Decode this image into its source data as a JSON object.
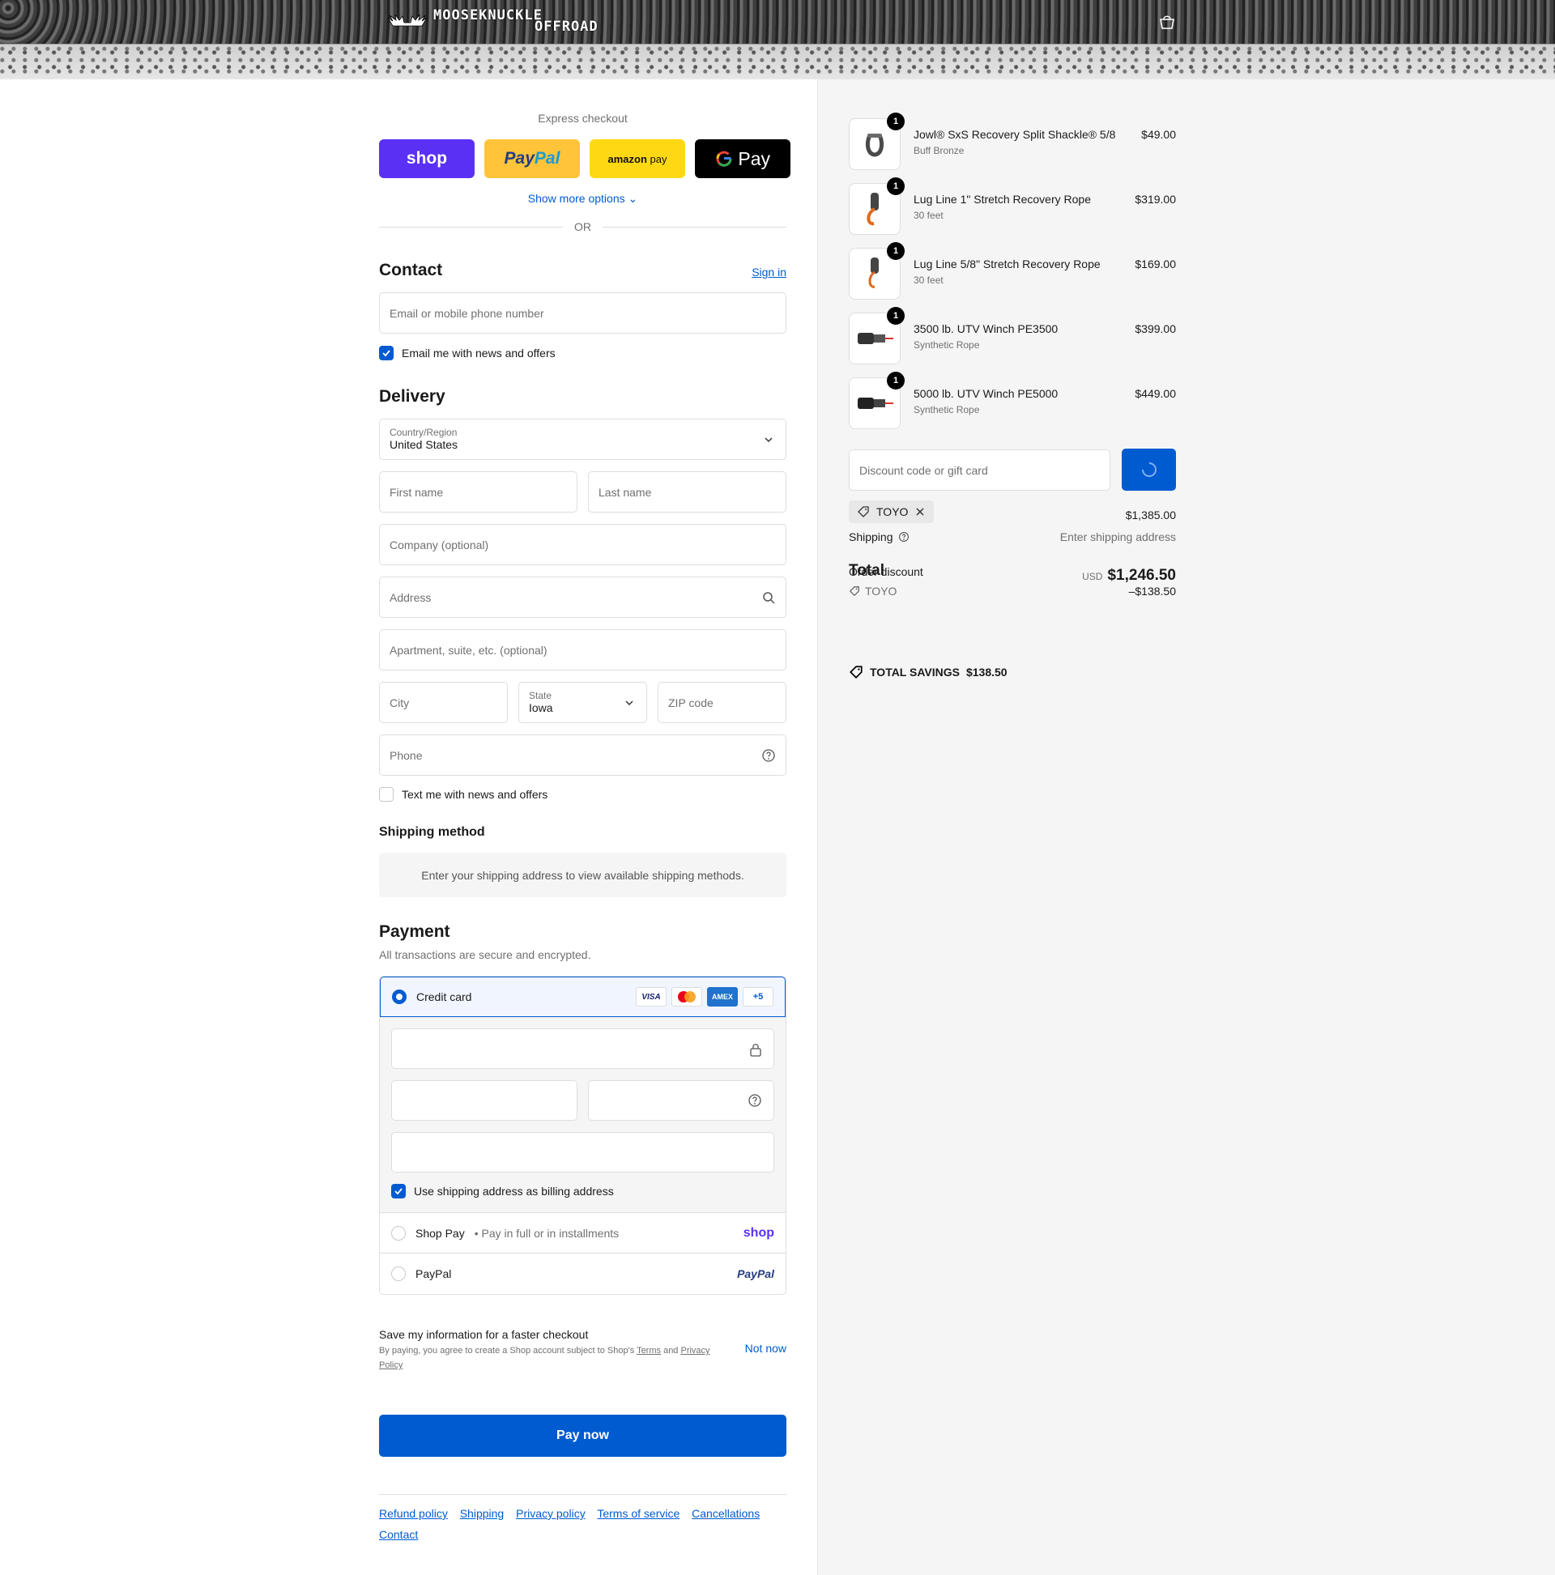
{
  "header": {
    "brand_line1": "MOOSEKNUCKLE",
    "brand_line2": "OFFROAD"
  },
  "express": {
    "title": "Express checkout",
    "shop_label": "shop",
    "paypal_a": "Pay",
    "paypal_b": "Pal",
    "amazon_label": "amazon",
    "amazon_pay": "pay",
    "gpay_label": "Pay",
    "show_more": "Show more options ⌄",
    "or": "OR"
  },
  "contact": {
    "title": "Contact",
    "sign_in": "Sign in",
    "email_placeholder": "Email or mobile phone number",
    "news_label": "Email me with news and offers"
  },
  "delivery": {
    "title": "Delivery",
    "country_label": "Country/Region",
    "country_value": "United States",
    "first_name": "First name",
    "last_name": "Last name",
    "company": "Company (optional)",
    "address": "Address",
    "apartment": "Apartment, suite, etc. (optional)",
    "city": "City",
    "state_label": "State",
    "state_value": "Iowa",
    "zip": "ZIP code",
    "phone": "Phone",
    "sms_label": "Text me with news and offers"
  },
  "shipping_method": {
    "title": "Shipping method",
    "message": "Enter your shipping address to view available shipping methods."
  },
  "payment": {
    "title": "Payment",
    "subtitle": "All transactions are secure and encrypted.",
    "credit_card": "Credit card",
    "badges": [
      "VISA",
      "",
      "AMEX",
      "+5"
    ],
    "billing_same": "Use shipping address as billing address",
    "shop_pay": "Shop Pay",
    "shop_pay_note": "• Pay in full or in installments",
    "shop_logo": "shop",
    "paypal": "PayPal",
    "paypal_logo": "PayPal"
  },
  "save_info": {
    "title": "Save my information for a faster checkout",
    "legal_prefix": "By paying, you agree to create a Shop account subject to Shop's ",
    "terms": "Terms",
    "and": " and ",
    "privacy": "Privacy Policy",
    "not_now": "Not now"
  },
  "pay_now": "Pay now",
  "footer_links": [
    "Refund policy",
    "Shipping",
    "Privacy policy",
    "Terms of service",
    "Cancellations",
    "Contact"
  ],
  "order": {
    "items": [
      {
        "qty": "1",
        "name": "Jowl® SxS Recovery Split Shackle® 5/8",
        "variant": "Buff Bronze",
        "price": "$49.00"
      },
      {
        "qty": "1",
        "name": "Lug Line 1\" Stretch Recovery Rope",
        "variant": "30 feet",
        "price": "$319.00"
      },
      {
        "qty": "1",
        "name": "Lug Line 5/8\" Stretch Recovery Rope",
        "variant": "30 feet",
        "price": "$169.00"
      },
      {
        "qty": "1",
        "name": "3500 lb. UTV Winch PE3500",
        "variant": "Synthetic Rope",
        "price": "$399.00"
      },
      {
        "qty": "1",
        "name": "5000 lb. UTV Winch PE5000",
        "variant": "Synthetic Rope",
        "price": "$449.00"
      }
    ],
    "discount_placeholder": "Discount code or gift card",
    "discount_code": "TOYO",
    "subtotal_value": "$1,385.00",
    "shipping_label": "Shipping",
    "shipping_value": "Enter shipping address",
    "total_label": "Total",
    "order_discount_label": "Order discount",
    "total_currency": "USD",
    "total_value": "$1,246.50",
    "discount_tag": "TOYO",
    "discount_amount": "–$138.50",
    "savings_label": "TOTAL SAVINGS",
    "savings_value": "$138.50"
  },
  "colors": {
    "accent": "#005bd1",
    "shop_purple": "#5a31f4",
    "paypal_yellow": "#ffc439",
    "amazon_yellow": "#ffd814"
  }
}
